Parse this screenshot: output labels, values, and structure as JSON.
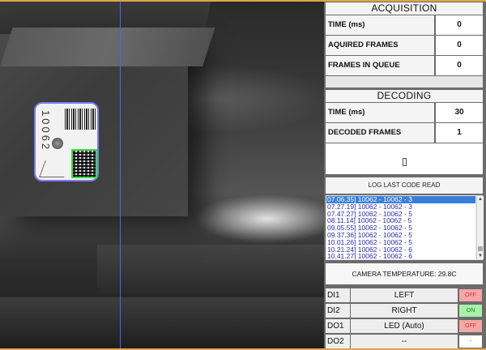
{
  "camera": {
    "label_number": "10062"
  },
  "acquisition": {
    "title": "ACQUISITION",
    "rows": [
      {
        "label": "TIME (ms)",
        "value": "0"
      },
      {
        "label": "AQUIRED FRAMES",
        "value": "0"
      },
      {
        "label": "FRAMES IN QUEUE",
        "value": "0"
      }
    ]
  },
  "decoding": {
    "title": "DECODING",
    "rows": [
      {
        "label": "TIME (ms)",
        "value": "30"
      },
      {
        "label": "DECODED FRAMES",
        "value": "1"
      }
    ]
  },
  "log": {
    "title": "LOG LAST CODE READ",
    "items": [
      "07.06.35] 10062 - 10062 - 3",
      "07.27.19] 10062 - 10062 - 3",
      "07.47.27] 10062 - 10062 - 5",
      "08.11.14] 10062 - 10062 - 5",
      "09.05.55] 10062 - 10062 - 5",
      "09.37.36] 10062 - 10062 - 5",
      "10.01.26] 10062 - 10062 - 5",
      "10.21.24] 10062 - 10062 - 6",
      "10.41.27] 10062 - 10062 - 6",
      "11.10.16] 10062 - 10062 - 5"
    ]
  },
  "temperature": "CAMERA TEMPERATURE: 29.8C",
  "io": [
    {
      "code": "DI1",
      "name": "LEFT",
      "state": "OFF",
      "color": "#f4a7a7",
      "text_color": "#e03030"
    },
    {
      "code": "DI2",
      "name": "RIGHT",
      "state": "ON",
      "color": "#a9f0a9",
      "text_color": "#1a8a1a"
    },
    {
      "code": "DO1",
      "name": "LED (Auto)",
      "state": "OFF",
      "color": "#f4a7a7",
      "text_color": "#e03030"
    },
    {
      "code": "DO2",
      "name": "--",
      "state": "-",
      "color": "#ffffff",
      "text_color": "#333333"
    }
  ]
}
